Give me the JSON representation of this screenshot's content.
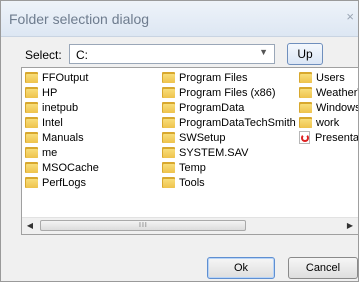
{
  "dialog": {
    "title": "Folder selection dialog",
    "close_glyph": "×"
  },
  "select": {
    "label": "Select:",
    "value": "C:",
    "arrow_glyph": "▼"
  },
  "up_button": {
    "label": "Up"
  },
  "list": {
    "columns": [
      [
        {
          "name": "FFOutput",
          "icon": "folder-icon"
        },
        {
          "name": "HP",
          "icon": "folder-icon"
        },
        {
          "name": "inetpub",
          "icon": "folder-icon"
        },
        {
          "name": "Intel",
          "icon": "folder-icon"
        },
        {
          "name": "Manuals",
          "icon": "folder-icon"
        },
        {
          "name": "me",
          "icon": "folder-icon"
        },
        {
          "name": "MSOCache",
          "icon": "folder-icon"
        },
        {
          "name": "PerfLogs",
          "icon": "folder-icon"
        }
      ],
      [
        {
          "name": "Program Files",
          "icon": "folder-icon"
        },
        {
          "name": "Program Files (x86)",
          "icon": "folder-icon"
        },
        {
          "name": "ProgramData",
          "icon": "folder-icon"
        },
        {
          "name": "ProgramDataTechSmith",
          "icon": "folder-icon"
        },
        {
          "name": "SWSetup",
          "icon": "folder-icon"
        },
        {
          "name": "SYSTEM.SAV",
          "icon": "folder-icon"
        },
        {
          "name": "Temp",
          "icon": "folder-icon"
        },
        {
          "name": "Tools",
          "icon": "folder-icon"
        }
      ],
      [
        {
          "name": "Users",
          "icon": "folder-icon"
        },
        {
          "name": "WeatherW",
          "icon": "folder-icon"
        },
        {
          "name": "Windows",
          "icon": "folder-icon"
        },
        {
          "name": "work",
          "icon": "folder-icon"
        },
        {
          "name": "Presentat",
          "icon": "pdf-icon"
        }
      ]
    ],
    "scroll_left_glyph": "◀",
    "scroll_right_glyph": "▶",
    "thumb_grip_glyph": "III"
  },
  "buttons": {
    "ok_label": "Ok",
    "cancel_label": "Cancel"
  }
}
